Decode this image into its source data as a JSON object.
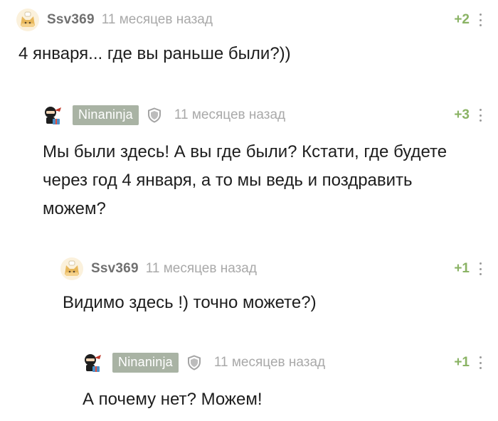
{
  "comments": [
    {
      "username": "Ssv369",
      "time": "11 месяцев назад",
      "rating": "+2",
      "avatar": "cat-avatar-icon",
      "text": "4 января... где вы раньше были?))"
    },
    {
      "username": "Ninaninja",
      "time": "11 месяцев назад",
      "rating": "+3",
      "avatar": "ninja-avatar-icon",
      "verified": "shield-icon",
      "text": "Мы были здесь! А вы где были? Кстати, где будете через год 4 января, а то мы ведь и поздравить можем?"
    },
    {
      "username": "Ssv369",
      "time": "11 месяцев назад",
      "rating": "+1",
      "avatar": "cat-avatar-icon",
      "text": "Видимо здесь !) точно можете?)"
    },
    {
      "username": "Ninaninja",
      "time": "11 месяцев назад",
      "rating": "+1",
      "avatar": "ninja-avatar-icon",
      "verified": "shield-icon",
      "text": "А почему нет? Можем!"
    }
  ],
  "colors": {
    "rating": "#8ab364",
    "badge": "#a9b3a4",
    "meta": "#a9a9a9"
  }
}
